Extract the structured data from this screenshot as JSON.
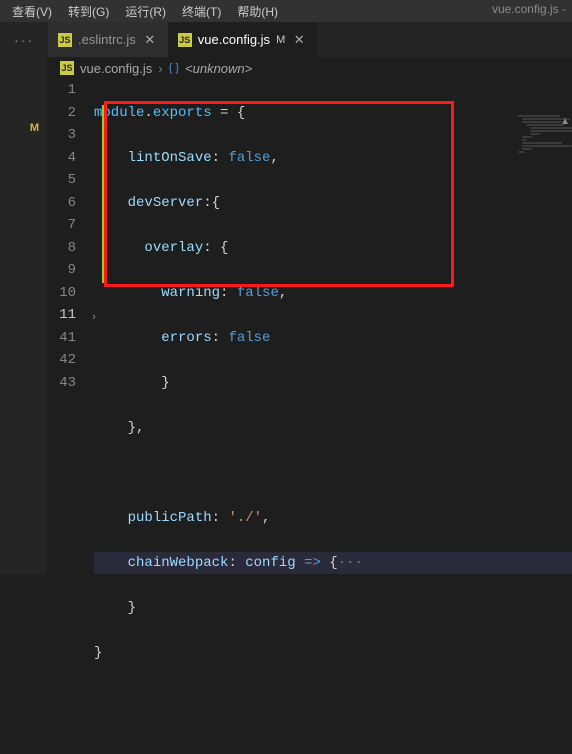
{
  "menu": {
    "view": "查看(V)",
    "goto": "转到(G)",
    "run": "运行(R)",
    "terminal": "终端(T)",
    "help": "帮助(H)"
  },
  "window_title": "vue.config.js -",
  "activity_icon": "···",
  "tabs": [
    {
      "icon": "JS",
      "label": ".eslintrc.js",
      "modified": ""
    },
    {
      "icon": "JS",
      "label": "vue.config.js",
      "modified": "M"
    }
  ],
  "sidebar": {
    "git_status": "M"
  },
  "breadcrumb": {
    "file_icon": "JS",
    "file": "vue.config.js",
    "sep": "›",
    "symbol_icon": "{ }",
    "symbol": "<unknown>"
  },
  "code": {
    "lines": [
      1,
      2,
      3,
      4,
      5,
      6,
      7,
      8,
      9,
      10,
      11,
      41,
      42,
      43
    ],
    "tokens": {
      "module": "module",
      "exports": "exports",
      "eq": " = ",
      "lbrace": "{",
      "rbrace": "}",
      "lintOnSave": "lintOnSave",
      "falseVal": "false",
      "devServer": "devServer",
      "overlay": "overlay",
      "warning": "warning",
      "errors": "errors",
      "publicPath": "publicPath",
      "pathStr": "'./'",
      "chainWebpack": "chainWebpack",
      "config": "config",
      "arrow": " => ",
      "ellipsis": "···",
      "comma": ",",
      "colon": ": "
    },
    "fold11": "›"
  },
  "scroll_arrow": "▲"
}
